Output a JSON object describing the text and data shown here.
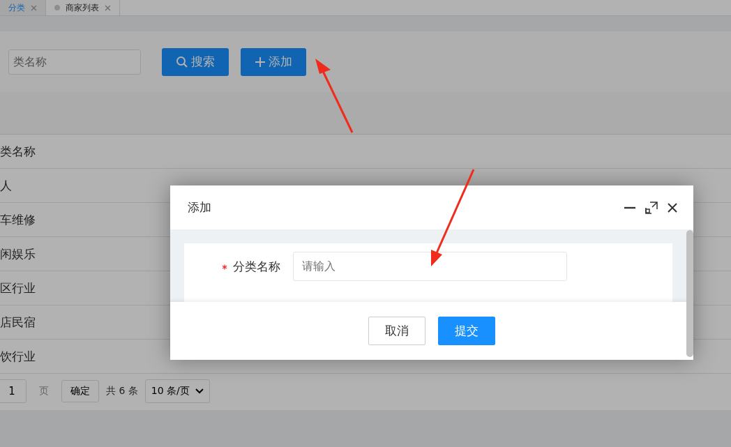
{
  "tabs": [
    {
      "label": "分类",
      "selected": true
    },
    {
      "label": "商家列表",
      "selected": false
    }
  ],
  "toolbar": {
    "search_field": {
      "placeholder": "类名称"
    },
    "buttons": [
      {
        "kind": "search",
        "label": "搜索"
      },
      {
        "kind": "add",
        "label": "添加"
      }
    ]
  },
  "table": {
    "header": "类名称",
    "rows": [
      "人",
      "车维修",
      "闲娱乐",
      "区行业",
      "店民宿",
      "饮行业"
    ]
  },
  "pagination": {
    "page_input": "1",
    "page_unit": "页",
    "confirm": "确定",
    "total": "共 6 条",
    "page_size": "10 条/页"
  },
  "dialog": {
    "title": "添加",
    "field": {
      "required": true,
      "label": "分类名称",
      "placeholder": "请输入"
    },
    "buttons": [
      {
        "kind": "cancel",
        "label": "取消"
      },
      {
        "kind": "submit",
        "label": "提交"
      }
    ]
  }
}
